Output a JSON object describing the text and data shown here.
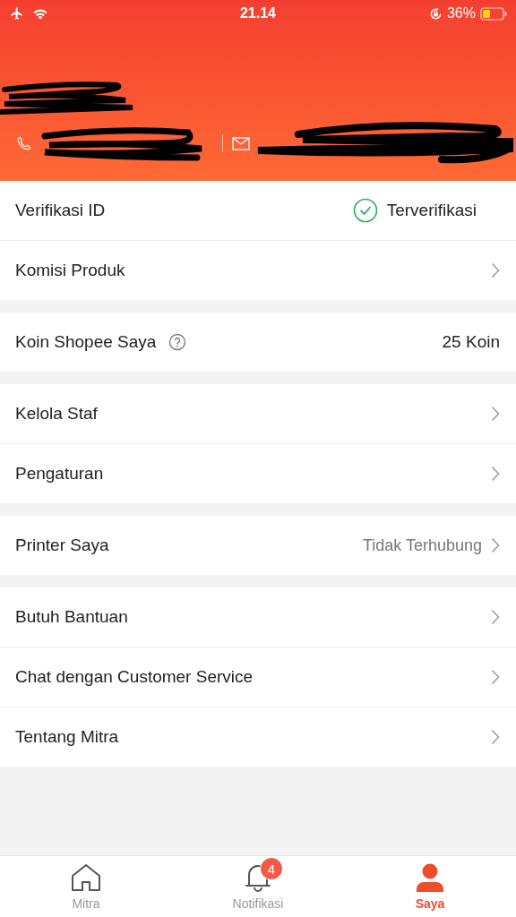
{
  "status_bar": {
    "time": "21.14",
    "battery": "36%"
  },
  "header": {
    "redacted": true
  },
  "groups": [
    {
      "rows": [
        {
          "kind": "status",
          "label": "Verifikasi ID",
          "value": "Terverifikasi"
        },
        {
          "kind": "link",
          "label": "Komisi Produk"
        }
      ]
    },
    {
      "rows": [
        {
          "kind": "help",
          "label": "Koin Shopee Saya",
          "value": "25 Koin"
        }
      ]
    },
    {
      "rows": [
        {
          "kind": "link",
          "label": "Kelola Staf"
        },
        {
          "kind": "link",
          "label": "Pengaturan"
        }
      ]
    },
    {
      "rows": [
        {
          "kind": "link",
          "label": "Printer Saya",
          "value": "Tidak Terhubung"
        }
      ]
    },
    {
      "rows": [
        {
          "kind": "link",
          "label": "Butuh Bantuan"
        },
        {
          "kind": "link",
          "label": "Chat dengan Customer Service"
        },
        {
          "kind": "link",
          "label": "Tentang Mitra"
        }
      ]
    }
  ],
  "tab_bar": [
    {
      "kind": "home",
      "label": "Mitra",
      "selected": false
    },
    {
      "kind": "bell",
      "label": "Notifikasi",
      "selected": false,
      "badge": "4"
    },
    {
      "kind": "person",
      "label": "Saya",
      "selected": true
    }
  ]
}
